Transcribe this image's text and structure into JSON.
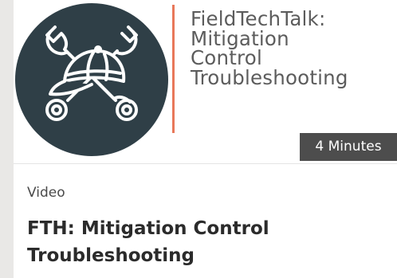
{
  "thumbnail": {
    "brand_lines": [
      "FieldTechTalk:",
      "Mitigation",
      "Control",
      "Troubleshooting"
    ],
    "duration": "4 Minutes",
    "logo_icon": "cap-and-wrenches-icon",
    "colors": {
      "logo_bg": "#2f3f47",
      "accent_line": "#e8785a",
      "duration_bg": "#4d4d4d"
    }
  },
  "content": {
    "type": "Video",
    "title": "FTH: Mitigation Control Troubleshooting"
  }
}
